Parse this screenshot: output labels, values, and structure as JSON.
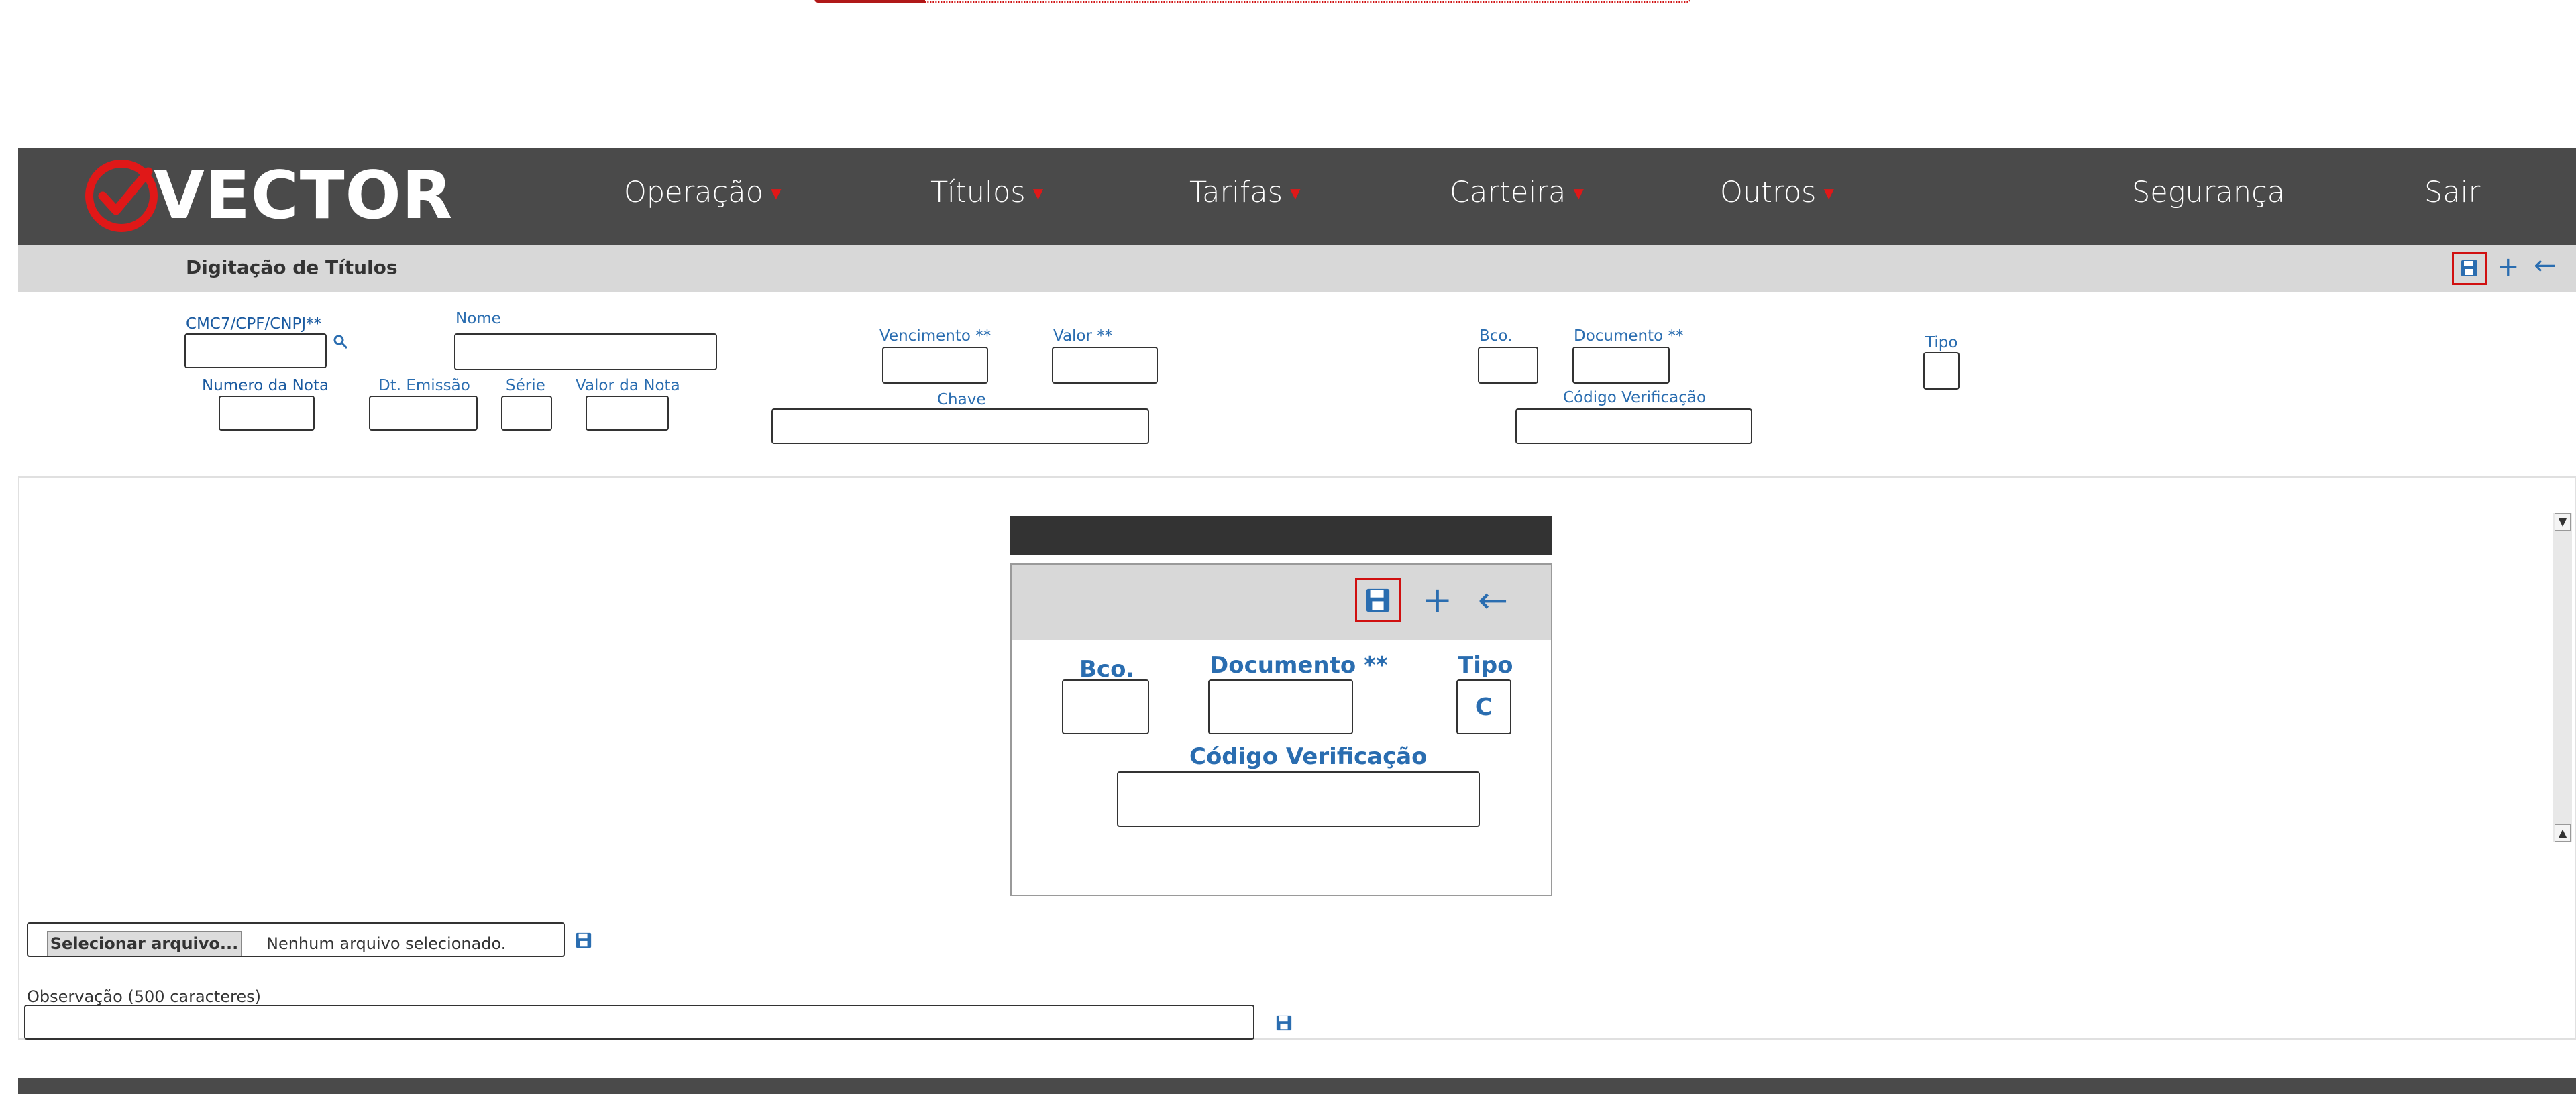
{
  "brand": {
    "name": "VECTOR",
    "accent": "#e01818"
  },
  "nav": {
    "items": [
      {
        "label": "Operação",
        "caret": "▼"
      },
      {
        "label": "Títulos",
        "caret": "▼"
      },
      {
        "label": "Tarifas",
        "caret": "▼"
      },
      {
        "label": "Carteira",
        "caret": "▼"
      },
      {
        "label": "Outros",
        "caret": "▼"
      },
      {
        "label": "Segurança"
      },
      {
        "label": "Sair"
      }
    ]
  },
  "page": {
    "title": "Digitação de Títulos"
  },
  "toolbar": {
    "save_icon": "floppy-disk-icon",
    "add_label": "+",
    "back_label": "←"
  },
  "form": {
    "cmc7_label": "CMC7/CPF/CNPJ**",
    "nome_label": "Nome",
    "vencimento_label": "Vencimento **",
    "valor_label": "Valor **",
    "bco_label": "Bco.",
    "documento_label": "Documento **",
    "tipo_label": "Tipo",
    "numero_nota_label": "Numero da Nota",
    "dt_emissao_label": "Dt. Emissão",
    "serie_label": "Série",
    "valor_nota_label": "Valor da Nota",
    "chave_label": "Chave",
    "codigo_verificacao_label": "Código Verificação"
  },
  "modal": {
    "bco_label": "Bco.",
    "documento_label": "Documento **",
    "tipo_label": "Tipo",
    "tipo_value": "C",
    "codigo_verificacao_label": "Código Verificação",
    "add_label": "+",
    "back_label": "←"
  },
  "scrollbar": {
    "up": "▲",
    "down": "▼"
  },
  "upload": {
    "button_label": "Selecionar arquivo...",
    "status": "Nenhum arquivo selecionado."
  },
  "observacao": {
    "label": "Observação (500 caracteres)",
    "value": ""
  }
}
